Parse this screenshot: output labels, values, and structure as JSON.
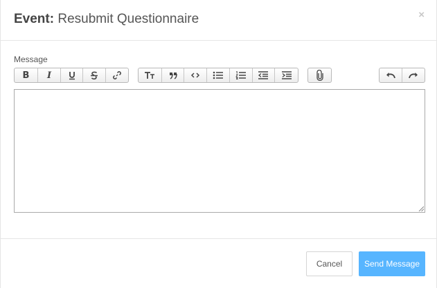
{
  "modal": {
    "title_label": "Event:",
    "title_value": "Resubmit Questionnaire",
    "close_glyph": "×"
  },
  "form": {
    "message_label": "Message",
    "message_value": ""
  },
  "toolbar": {
    "groups": [
      {
        "name": "text-style",
        "buttons": [
          "bold-icon",
          "italic-icon",
          "underline-icon",
          "strikethrough-icon",
          "link-icon"
        ]
      },
      {
        "name": "block",
        "buttons": [
          "text-size-icon",
          "quote-icon",
          "code-icon",
          "bullet-list-icon",
          "numbered-list-icon",
          "outdent-icon",
          "indent-icon"
        ]
      },
      {
        "name": "attach",
        "buttons": [
          "paperclip-icon"
        ]
      },
      {
        "name": "history",
        "buttons": [
          "undo-icon",
          "redo-icon"
        ]
      }
    ],
    "bold_glyph": "B",
    "italic_glyph": "I"
  },
  "footer": {
    "cancel_label": "Cancel",
    "send_label": "Send Message"
  },
  "colors": {
    "primary": "#57b5ff",
    "border": "#e5e5e5",
    "text": "#555555"
  }
}
